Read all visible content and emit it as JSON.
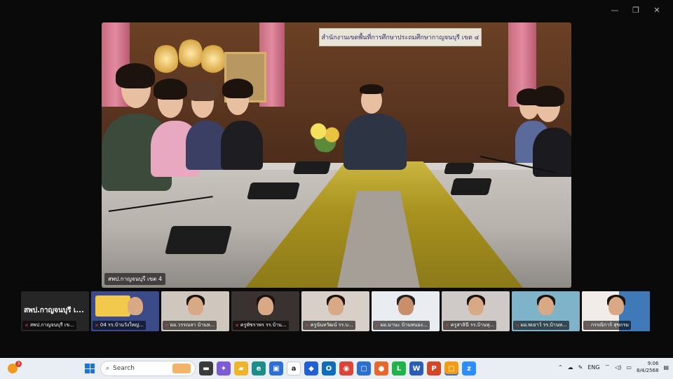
{
  "window": {
    "controls": [
      "minimize",
      "maximize",
      "close"
    ],
    "control_glyphs": [
      "—",
      "❐",
      "✕"
    ]
  },
  "main_video": {
    "participant_label": "สพป.กาญจนบุรี เขต 4",
    "room_sign": "สำนักงานเขตพื้นที่การศึกษาประถมศึกษากาญจนบุรี เขต ๔"
  },
  "gallery": {
    "first_tile_title": "สพป.กาญจนบุรี เ...",
    "tiles": [
      {
        "label": "สพป.กาญจนบุรี เข..."
      },
      {
        "label": "04 รร.บ้านวังใหญ่..."
      },
      {
        "label": "ผอ.วรรณลา บ้านห..."
      },
      {
        "label": "ครูพัชราพร รร.บ้าน..."
      },
      {
        "label": "ครูนันทวัฒน์ รร.บ..."
      },
      {
        "label": "ผอ.มานะ บ้านหนอง..."
      },
      {
        "label": "ครูสาลินี รร.บ้านหุ..."
      },
      {
        "label": "ผอ.พเยาว์ รร.บ้านห..."
      },
      {
        "label": "กรรณิการ์ สุขกรม"
      }
    ]
  },
  "taskbar": {
    "weather_badge": "3",
    "search_placeholder": "Search",
    "apps": [
      {
        "icon": "file-explorer-icon",
        "glyph": "▬",
        "color": "#3a3a3a"
      },
      {
        "icon": "copilot-icon",
        "glyph": "✦",
        "color": "#7c5cd6"
      },
      {
        "icon": "folder-icon",
        "glyph": "▰",
        "color": "#f0b429"
      },
      {
        "icon": "edge-icon",
        "glyph": "e",
        "color": "#1a8f8a"
      },
      {
        "icon": "store-icon",
        "glyph": "▣",
        "color": "#2d6fd3"
      },
      {
        "icon": "amazon-icon",
        "glyph": "a",
        "color": "#ffffff"
      },
      {
        "icon": "dropbox-icon",
        "glyph": "◆",
        "color": "#2061d6"
      },
      {
        "icon": "outlook-icon",
        "glyph": "O",
        "color": "#0f6cbd"
      },
      {
        "icon": "chrome-icon",
        "glyph": "◉",
        "color": "#db4437"
      },
      {
        "icon": "screenshot-icon",
        "glyph": "▢",
        "color": "#2b6fd1"
      },
      {
        "icon": "firefox-icon",
        "glyph": "●",
        "color": "#e8672b"
      },
      {
        "icon": "line-icon",
        "glyph": "L",
        "color": "#20b34a"
      },
      {
        "icon": "word-icon",
        "glyph": "W",
        "color": "#2b5cb8"
      },
      {
        "icon": "powerpoint-icon",
        "glyph": "P",
        "color": "#d24726"
      },
      {
        "icon": "app-orange-icon",
        "glyph": "▢",
        "color": "#f39c12"
      },
      {
        "icon": "zoom-icon",
        "glyph": "z",
        "color": "#2d8cff"
      }
    ],
    "tray": {
      "language": "ENG",
      "time": "9:06",
      "date": "8/4/2568"
    }
  }
}
